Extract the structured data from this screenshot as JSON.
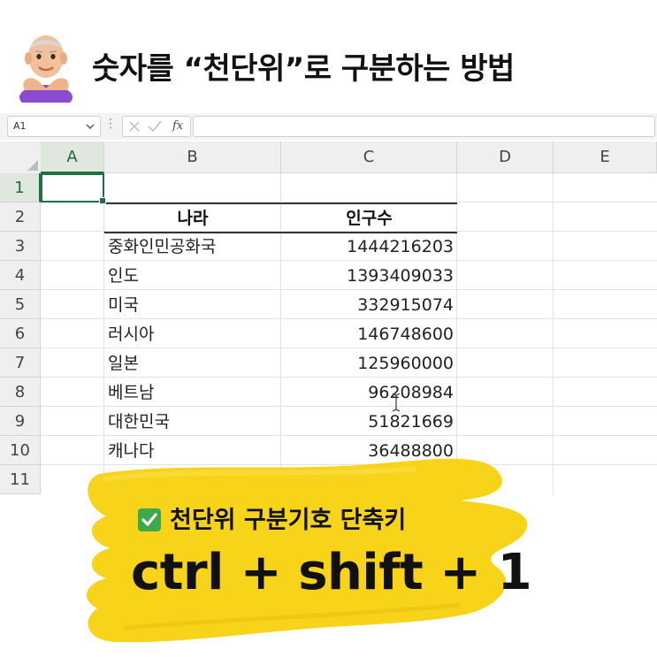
{
  "title": "숫자를 “천단위”로 구분하는 방법",
  "formula_bar": {
    "name_box": "A1",
    "fx_label": "fx",
    "formula": ""
  },
  "columns": [
    "A",
    "B",
    "C",
    "D",
    "E"
  ],
  "rows": [
    "1",
    "2",
    "3",
    "4",
    "5",
    "6",
    "7",
    "8",
    "9",
    "10",
    "11"
  ],
  "table": {
    "headers": [
      "나라",
      "인구수"
    ],
    "rows": [
      [
        "중화인민공화국",
        "1444216203"
      ],
      [
        "인도",
        "1393409033"
      ],
      [
        "미국",
        "332915074"
      ],
      [
        "러시아",
        "146748600"
      ],
      [
        "일본",
        "125960000"
      ],
      [
        "베트남",
        "96208984"
      ],
      [
        "대한민국",
        "51821669"
      ],
      [
        "캐나다",
        "36488800"
      ]
    ]
  },
  "tip": {
    "label": "천단위 구분기호 단축키",
    "shortcut": "ctrl + shift + 1"
  },
  "colors": {
    "accent_green": "#1e7145",
    "brush_yellow": "#f7d31a",
    "check_green": "#3ea84a"
  }
}
